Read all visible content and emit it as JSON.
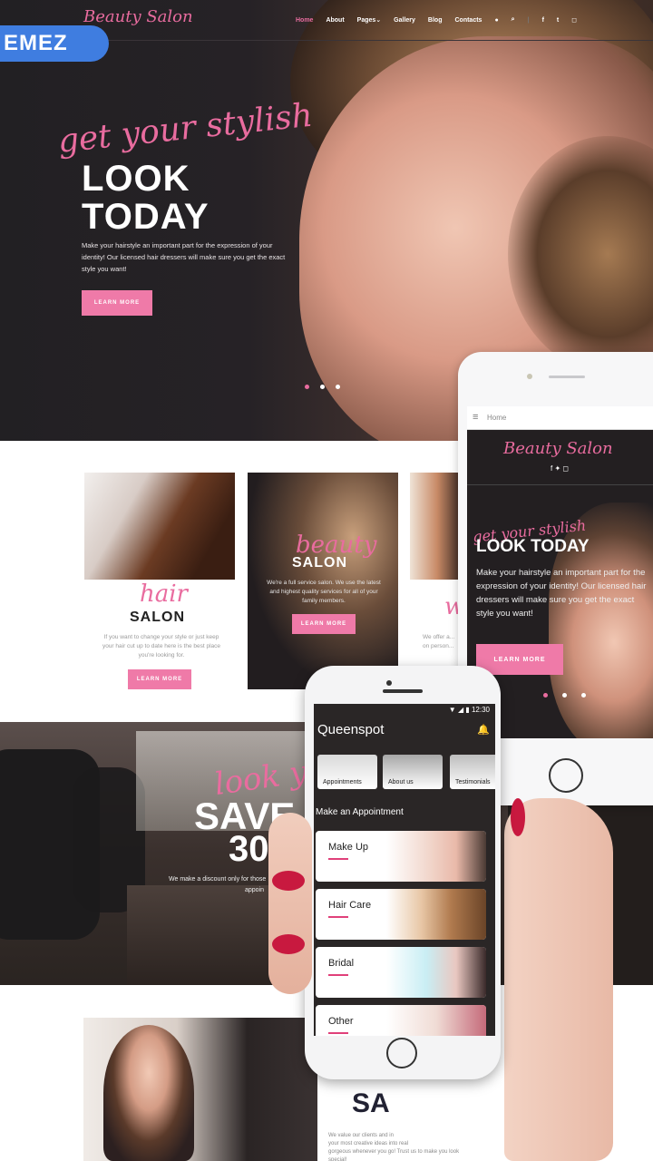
{
  "brand": {
    "name": "Beauty Salon",
    "badge": "EMEZ"
  },
  "nav": {
    "items": [
      "Home",
      "About",
      "Pages",
      "Gallery",
      "Blog",
      "Contacts"
    ],
    "active": "Home"
  },
  "hero": {
    "script": "get your stylish",
    "line1": "LOOK",
    "line2": "TODAY",
    "description": "Make your hairstyle an important part for the expression of your identity! Our licensed hair dressers will make sure you get the exact style you want!",
    "button": "LEARN MORE"
  },
  "cards": [
    {
      "script": "hair",
      "title": "SALON",
      "text": "If you want to change your style or just keep your hair cut up to date here is the best place you're looking for.",
      "button": "LEARN MORE"
    },
    {
      "script": "beauty",
      "title": "SALON",
      "text": "We're a full service salon. We use the latest and highest quality services for all of your family members.",
      "button": "LEARN MORE"
    },
    {
      "script": "w",
      "text": "We offer a... on person..."
    }
  ],
  "salon": {
    "script": "look your",
    "line1": "SAVE",
    "line2": "30",
    "text": "We make a discount only for those",
    "text2": "appoin"
  },
  "bottom": {
    "big": "SA",
    "text1": "We value our clients and in",
    "text2": "your most creative ideas into real",
    "text3": "gorgeous whenever you go! Trust us to make you look special!"
  },
  "tablet": {
    "menu": "Home",
    "brand": "Beauty Salon",
    "script": "get your stylish",
    "title": "LOOK TODAY",
    "description": "Make your hairstyle an important part for the expression of your identity! Our licensed hair dressers will make sure you get the exact style you want!",
    "button": "LEARN MORE"
  },
  "phone": {
    "time": "12:30",
    "app_title": "Queenspot",
    "tabs": [
      "Appointments",
      "About us",
      "Testimonials"
    ],
    "section": "Make an Appointment",
    "services": [
      "Make Up",
      "Hair Care",
      "Bridal",
      "Other"
    ]
  },
  "colors": {
    "accent": "#e96c9f",
    "button": "#ef7aa8",
    "dark": "#231f21",
    "badge": "#3f7de0"
  }
}
